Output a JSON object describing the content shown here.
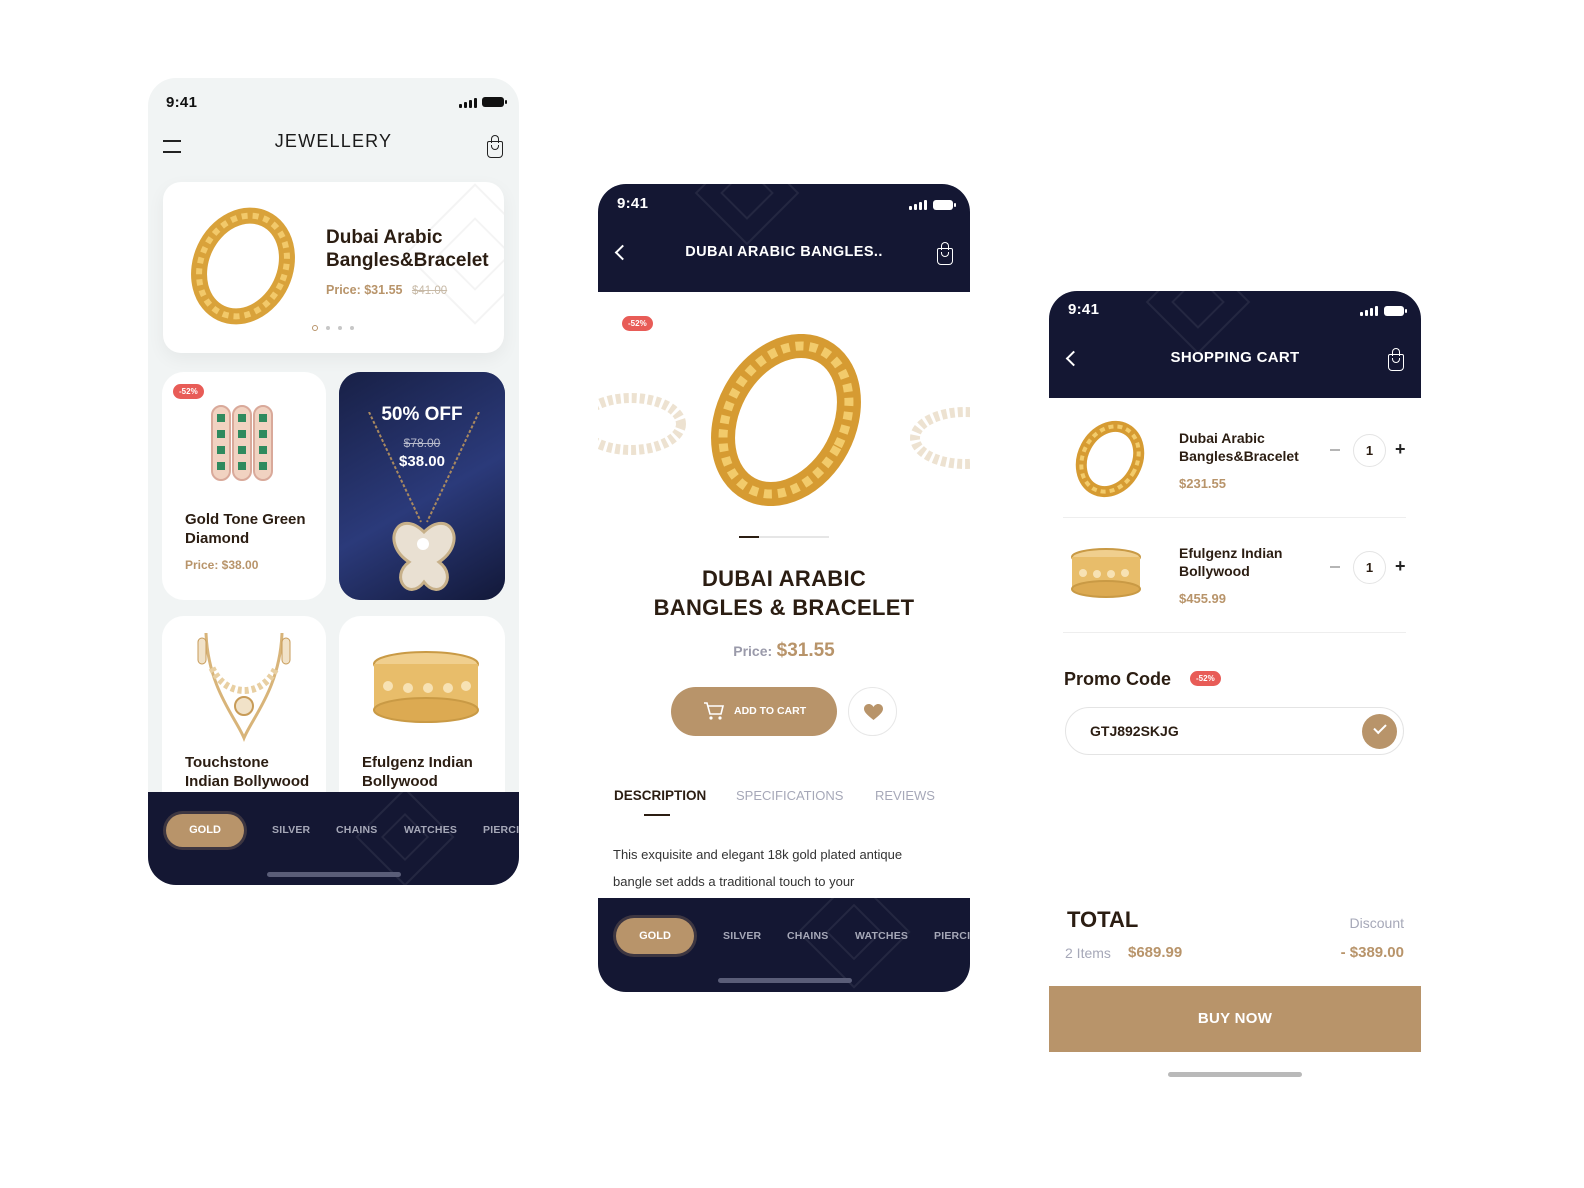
{
  "status": {
    "time": "9:41"
  },
  "home": {
    "title": "JEWELLERY",
    "hero": {
      "name_line1": "Dubai Arabic",
      "name_line2": "Bangles&Bracelet",
      "price_label": "Price:",
      "price": "$31.55",
      "old_price": "$41.00"
    },
    "card1": {
      "badge": "-52%",
      "name_line1": "Gold Tone Green",
      "name_line2": "Diamond",
      "price": "Price: $38.00"
    },
    "promo": {
      "title": "50% OFF",
      "old_price": "$78.00",
      "price": "$38.00"
    },
    "card3": {
      "name_line1": "Touchstone",
      "name_line2": "Indian Bollywood"
    },
    "card4": {
      "name_line1": "Efulgenz Indian",
      "name_line2": "Bollywood"
    }
  },
  "tabs": [
    "GOLD",
    "SILVER",
    "CHAINS",
    "WATCHES",
    "PIERCI"
  ],
  "detail": {
    "header_title": "DUBAI ARABIC BANGLES..",
    "badge": "-52%",
    "title_line1": "DUBAI ARABIC",
    "title_line2": "BANGLES & BRACELET",
    "price_label": "Price:",
    "price": "$31.55",
    "add_to_cart": "ADD TO CART",
    "tabs": [
      "DESCRIPTION",
      "SPECIFICATIONS",
      "REVIEWS"
    ],
    "description_line1": "This exquisite and elegant 18k gold plated antique",
    "description_line2": "bangle set adds a traditional touch to your"
  },
  "cart": {
    "header_title": "SHOPPING CART",
    "items": [
      {
        "name_line1": "Dubai Arabic",
        "name_line2": "Bangles&Bracelet",
        "price": "$231.55",
        "qty": "1"
      },
      {
        "name_line1": "Efulgenz Indian",
        "name_line2": "Bollywood",
        "price": "$455.99",
        "qty": "1"
      }
    ],
    "promo_label": "Promo Code",
    "promo_badge": "-52%",
    "promo_code": "GTJ892SKJG",
    "total_label": "TOTAL",
    "items_count": "2 Items",
    "total": "$689.99",
    "discount_label": "Discount",
    "discount": "- $389.00",
    "buy_now": "BUY NOW"
  },
  "colors": {
    "navy": "#141733",
    "gold": "#b8946a",
    "badge": "#e85c57"
  }
}
